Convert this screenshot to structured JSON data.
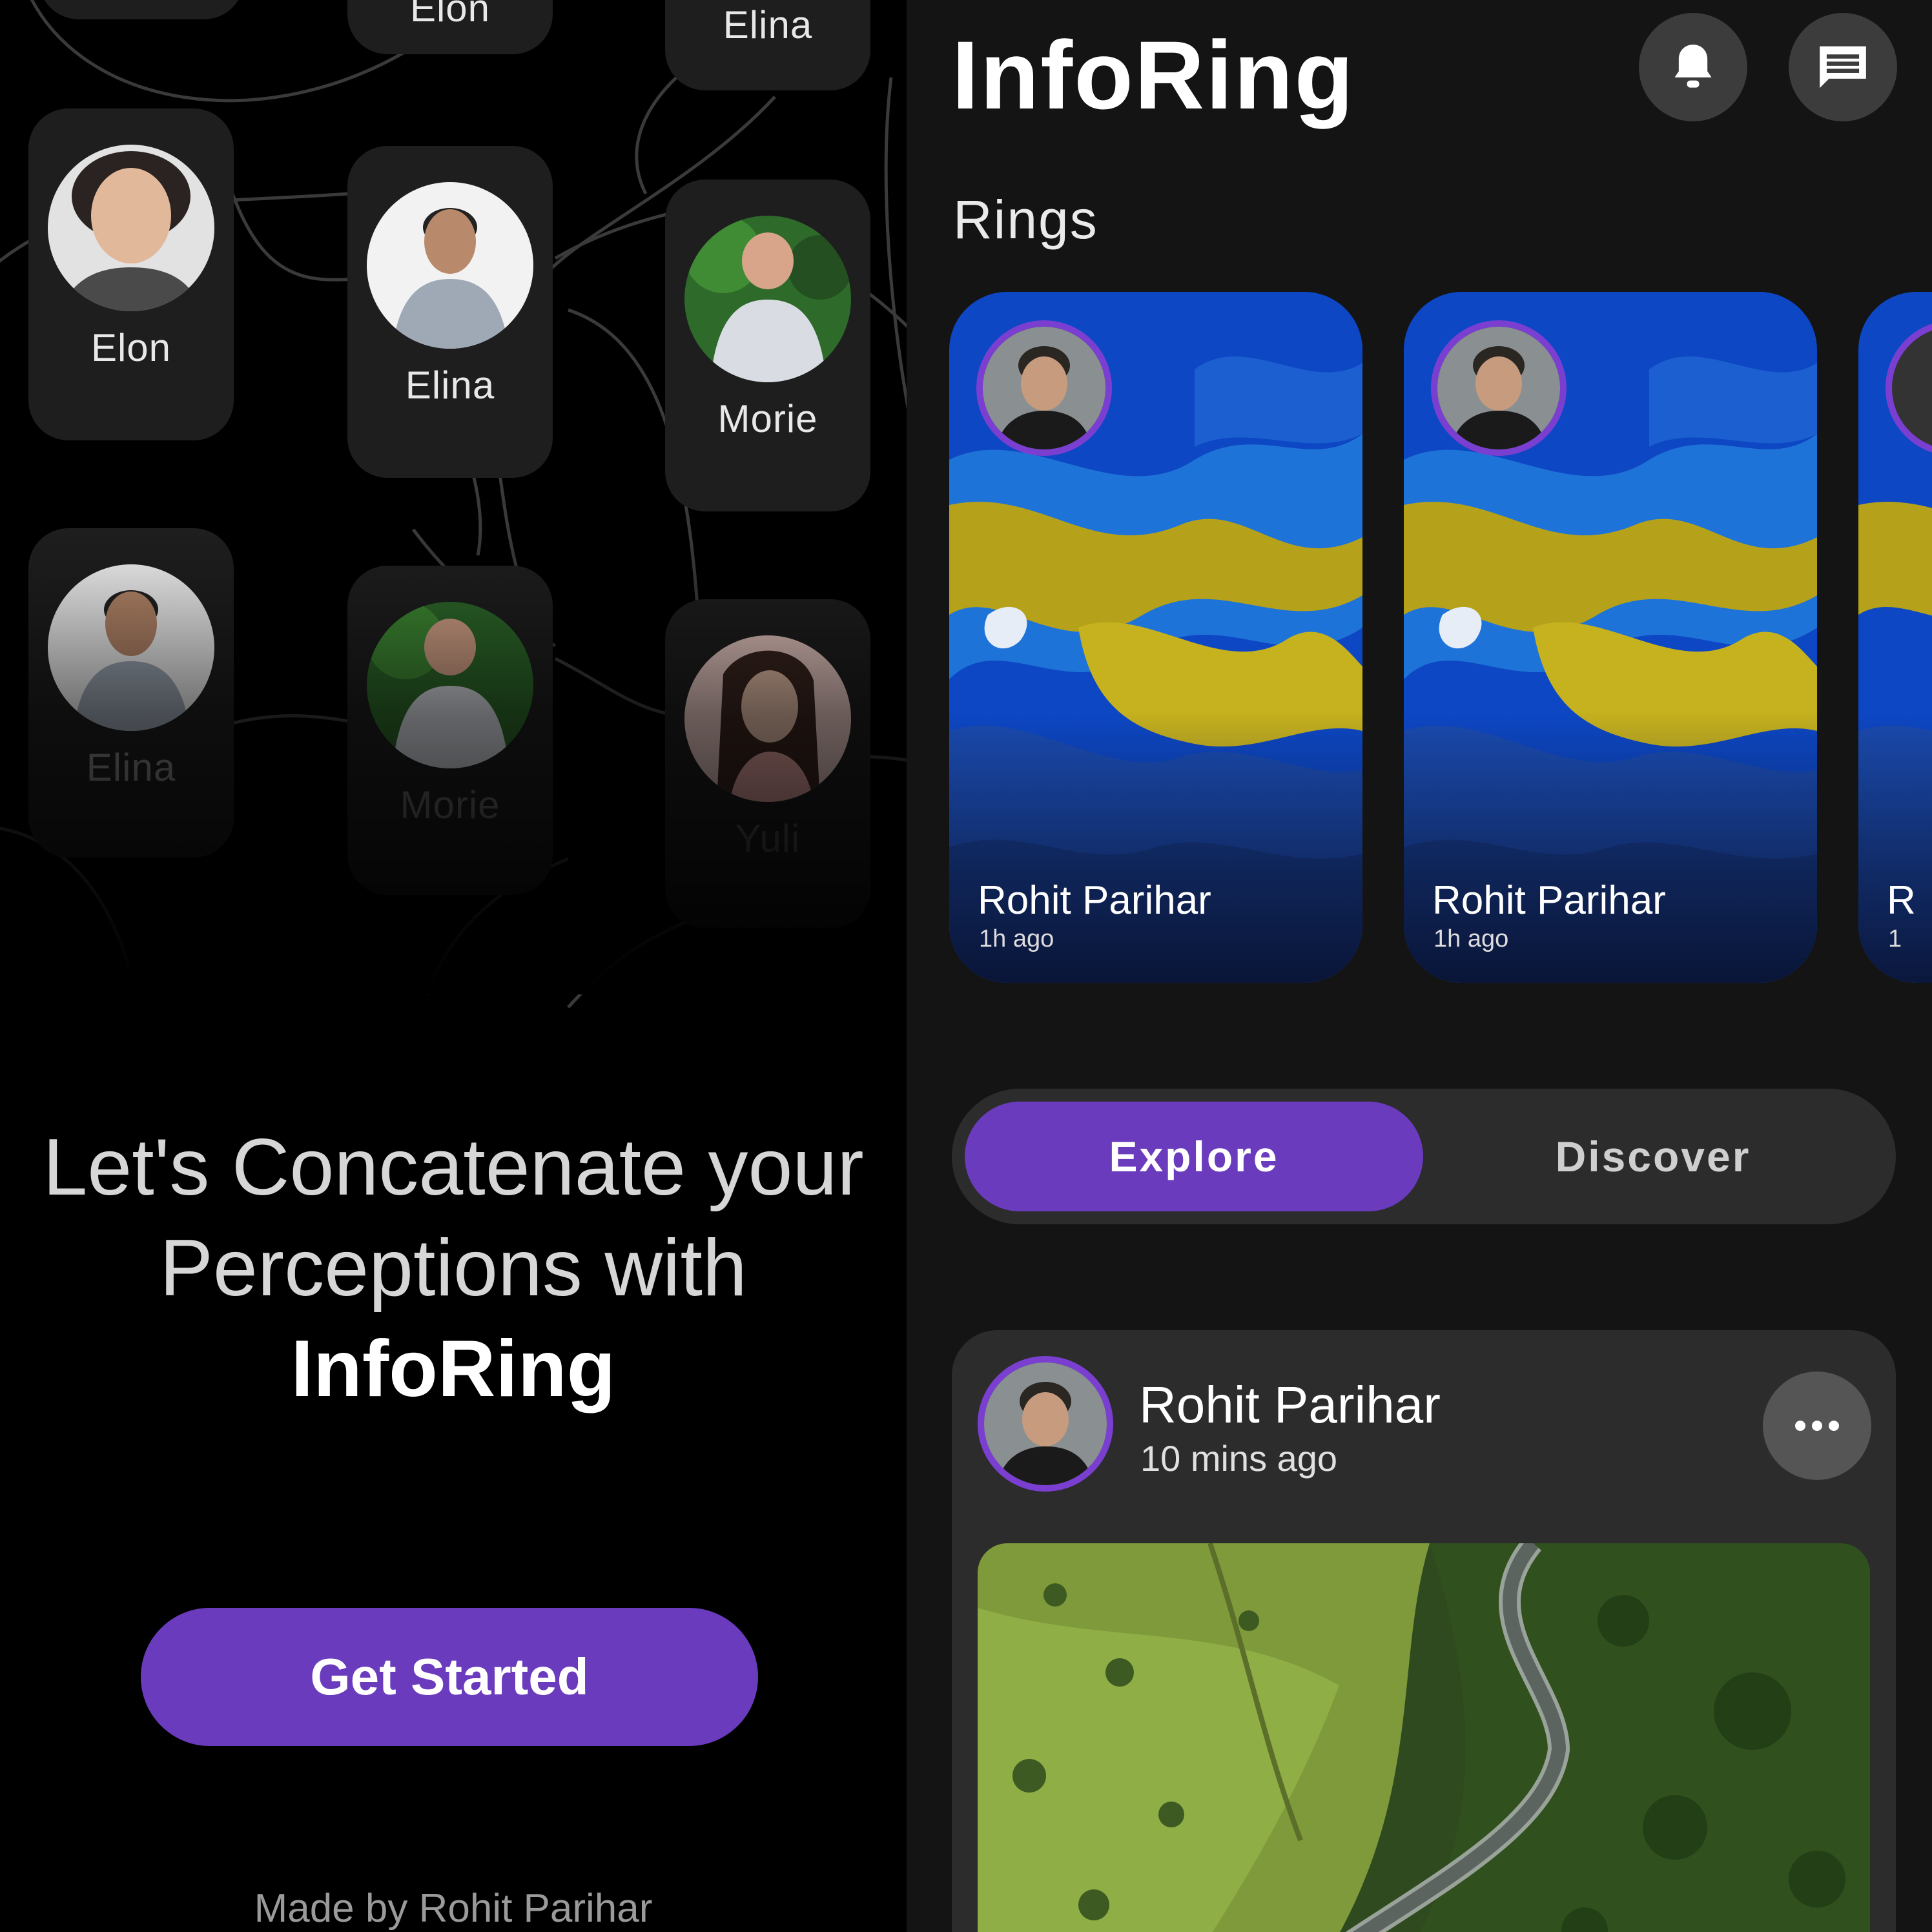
{
  "left": {
    "network_nodes": [
      {
        "name": "Elon"
      },
      {
        "name": "Elina"
      },
      {
        "name": "Morie"
      },
      {
        "name": "Elina"
      },
      {
        "name": "Morie"
      },
      {
        "name": "Yuli"
      },
      {
        "name": "Elon"
      },
      {
        "name": "Elina"
      }
    ],
    "tagline": {
      "line1": "Let's Concatenate your",
      "line2": "Perceptions with",
      "brand": "InfoRing"
    },
    "cta_label": "Get Started",
    "credit": "Made by Rohit Parihar"
  },
  "app": {
    "title": "InfoRing",
    "icons": {
      "notifications": "bell-icon",
      "messages": "chat-icon",
      "more": "more-horizontal-icon"
    },
    "rings_label": "Rings",
    "rings": [
      {
        "name": "Rohit Parihar",
        "time": "1h ago"
      },
      {
        "name": "Rohit Parihar",
        "time": "1h ago"
      },
      {
        "name": "R",
        "time": "1"
      }
    ],
    "tabs": [
      {
        "label": "Explore",
        "active": true
      },
      {
        "label": "Discover",
        "active": false
      }
    ],
    "post": {
      "author": "Rohit Parihar",
      "time": "10 mins ago"
    }
  },
  "colors": {
    "accent": "#6a3bbd",
    "ring_border": "#7a3fd1",
    "background_left": "#000000",
    "background_right": "#141414",
    "card": "#2c2c2c"
  }
}
